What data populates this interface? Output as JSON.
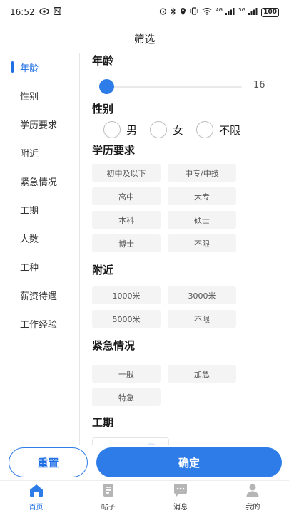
{
  "status": {
    "time": "16:52",
    "signal_1": "4G",
    "signal_2": "5G",
    "battery": "100"
  },
  "header": {
    "title": "筛选"
  },
  "sidebar": {
    "items": [
      {
        "label": "年龄"
      },
      {
        "label": "性别"
      },
      {
        "label": "学历要求"
      },
      {
        "label": "附近"
      },
      {
        "label": "紧急情况"
      },
      {
        "label": "工期"
      },
      {
        "label": "人数"
      },
      {
        "label": "工种"
      },
      {
        "label": "薪资待遇"
      },
      {
        "label": "工作经验"
      }
    ],
    "active_index": 0
  },
  "age": {
    "title": "年龄",
    "value": "16"
  },
  "gender": {
    "title": "性别",
    "options": [
      "男",
      "女",
      "不限"
    ]
  },
  "education": {
    "title": "学历要求",
    "options": [
      "初中及以下",
      "中专/中技",
      "高中",
      "大专",
      "本科",
      "硕士",
      "博士",
      "不限"
    ]
  },
  "nearby": {
    "title": "附近",
    "options": [
      "1000米",
      "3000米",
      "5000米",
      "不限"
    ]
  },
  "urgency": {
    "title": "紧急情况",
    "options": [
      "一般",
      "加急",
      "特急"
    ]
  },
  "duration": {
    "title": "工期"
  },
  "buttons": {
    "reset": "重置",
    "confirm": "确定"
  },
  "tabs": [
    {
      "label": "首页",
      "icon": "home-icon"
    },
    {
      "label": "帖子",
      "icon": "posts-icon"
    },
    {
      "label": "消息",
      "icon": "message-icon"
    },
    {
      "label": "我的",
      "icon": "profile-icon"
    }
  ],
  "colors": {
    "accent": "#2d7ce8",
    "chip_bg": "#f4f4f4"
  }
}
